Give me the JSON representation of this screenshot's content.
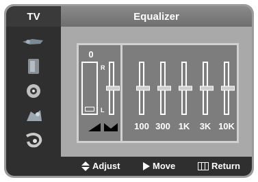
{
  "header": {
    "section": "TV",
    "title": "Equalizer"
  },
  "sidebar": {
    "items": [
      {
        "icon": "input-source-icon"
      },
      {
        "icon": "picture-icon"
      },
      {
        "icon": "sound-icon"
      },
      {
        "icon": "channel-icon"
      },
      {
        "icon": "setup-icon"
      }
    ]
  },
  "equalizer": {
    "balance_value": "0",
    "right_label": "R",
    "left_label": "L",
    "balance_level": 0.0,
    "band_labels": [
      "100",
      "300",
      "1K",
      "3K",
      "10K"
    ],
    "band_levels": [
      0.5,
      0.5,
      0.5,
      0.5,
      0.5
    ],
    "balance_slider_level": 0.5
  },
  "footer": {
    "adjust": "Adjust",
    "move": "Move",
    "return": "Return"
  }
}
